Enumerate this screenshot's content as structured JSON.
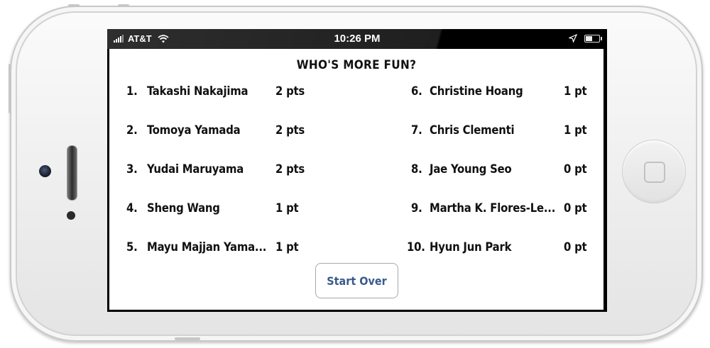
{
  "status_bar": {
    "carrier": "AT&T",
    "time": "10:26 PM",
    "icons": [
      "signal-icon",
      "wifi-icon",
      "location-icon",
      "battery-icon"
    ]
  },
  "title": "WHO'S MORE FUN?",
  "scores_left": [
    {
      "rank": "1.",
      "name": "Takashi Nakajima",
      "pts": "2 pts"
    },
    {
      "rank": "2.",
      "name": "Tomoya Yamada",
      "pts": "2 pts"
    },
    {
      "rank": "3.",
      "name": "Yudai Maruyama",
      "pts": "2 pts"
    },
    {
      "rank": "4.",
      "name": "Sheng Wang",
      "pts": "1 pt"
    },
    {
      "rank": "5.",
      "name": "Mayu Majjan Yama...",
      "pts": "1 pt"
    }
  ],
  "scores_right": [
    {
      "rank": "6.",
      "name": "Christine Hoang",
      "pts": "1 pt"
    },
    {
      "rank": "7.",
      "name": "Chris Clementi",
      "pts": "1 pt"
    },
    {
      "rank": "8.",
      "name": "Jae Young Seo",
      "pts": "0 pt"
    },
    {
      "rank": "9.",
      "name": "Martha K. Flores-Le...",
      "pts": "0 pt"
    },
    {
      "rank": "10.",
      "name": "Hyun Jun Park",
      "pts": "0 pt"
    }
  ],
  "start_over_label": "Start Over",
  "colors": {
    "button_text": "#3a5a8c",
    "screen_bg": "#ffffff",
    "status_bg": "#000000"
  }
}
